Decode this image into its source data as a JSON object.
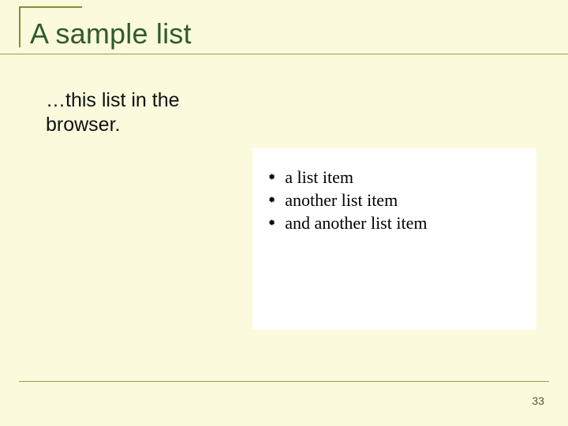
{
  "title": "A sample list",
  "caption_line1": "…this list in the",
  "caption_line2": "browser.",
  "list_items": {
    "0": "a list item",
    "1": "another list item",
    "2": "and another list item"
  },
  "page_number": "33",
  "bullet_glyph": "✹"
}
